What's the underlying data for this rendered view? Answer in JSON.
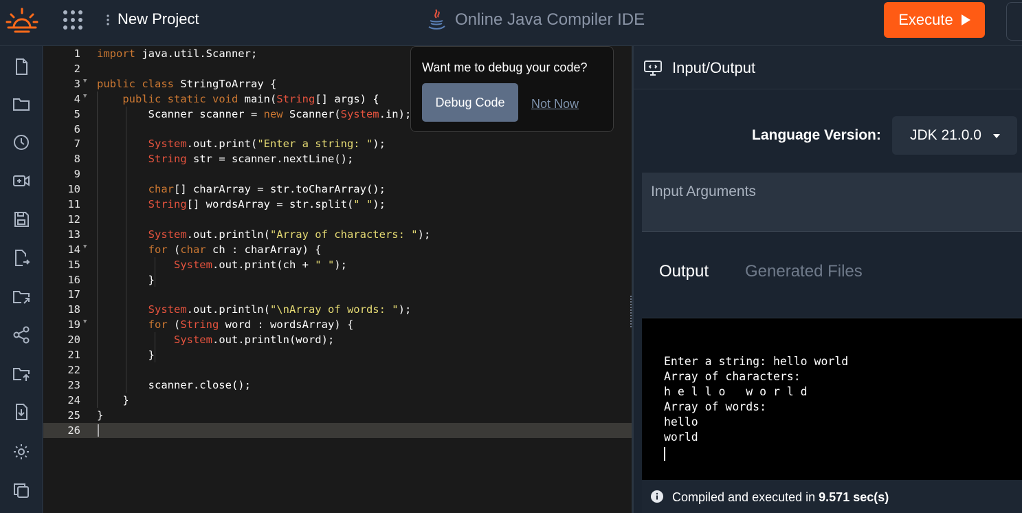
{
  "header": {
    "project_title": "New Project",
    "app_title": "Online Java Compiler IDE",
    "execute_label": "Execute"
  },
  "sidebar": {
    "icons": [
      "file-icon",
      "folder-icon",
      "history-icon",
      "video-add-icon",
      "save-icon",
      "file-export-icon",
      "folder-share-icon",
      "share-icon",
      "folder-upload-icon",
      "download-icon",
      "settings-icon",
      "copy-icon"
    ]
  },
  "editor": {
    "lines": [
      {
        "n": "1",
        "fold": "",
        "html": "import java.util.Scanner;"
      },
      {
        "n": "2",
        "fold": "",
        "html": ""
      },
      {
        "n": "3",
        "fold": "▼",
        "html": "public class StringToArray {"
      },
      {
        "n": "4",
        "fold": "▼",
        "html": "    public static void main(<span class=\"ty\">String</span>[] args) {"
      },
      {
        "n": "5",
        "fold": "",
        "html": "        Scanner scanner = new Scanner(<span class=\"ty\">System</span>.in);"
      },
      {
        "n": "6",
        "fold": "",
        "html": ""
      },
      {
        "n": "7",
        "fold": "",
        "html": "        <span class=\"ty\">System</span>.out.print(<span class=\"str\">\"Enter a string: \"</span>);"
      },
      {
        "n": "8",
        "fold": "",
        "html": "        <span class=\"ty\">String</span> str = scanner.nextLine();"
      },
      {
        "n": "9",
        "fold": "",
        "html": ""
      },
      {
        "n": "10",
        "fold": "",
        "html": "        <span class=\"kw\">char</span>[] charArray = str.toCharArray();"
      },
      {
        "n": "11",
        "fold": "",
        "html": "        <span class=\"ty\">String</span>[] wordsArray = str.split(<span class=\"str\">\" \"</span>);"
      },
      {
        "n": "12",
        "fold": "",
        "html": ""
      },
      {
        "n": "13",
        "fold": "",
        "html": "        <span class=\"ty\">System</span>.out.println(<span class=\"str\">\"Array of characters: \"</span>);"
      },
      {
        "n": "14",
        "fold": "▼",
        "html": "        <span class=\"kw\">for</span> (<span class=\"kw\">char</span> ch : charArray) {"
      },
      {
        "n": "15",
        "fold": "",
        "html": "            <span class=\"ty\">System</span>.out.print(ch + <span class=\"str\">\" \"</span>);"
      },
      {
        "n": "16",
        "fold": "",
        "html": "        }"
      },
      {
        "n": "17",
        "fold": "",
        "html": ""
      },
      {
        "n": "18",
        "fold": "",
        "html": "        <span class=\"ty\">System</span>.out.println(<span class=\"str\">\"\\nArray of words: \"</span>);"
      },
      {
        "n": "19",
        "fold": "▼",
        "html": "        <span class=\"kw\">for</span> (<span class=\"ty\">String</span> word : wordsArray) {"
      },
      {
        "n": "20",
        "fold": "",
        "html": "            <span class=\"ty\">System</span>.out.println(word);"
      },
      {
        "n": "21",
        "fold": "",
        "html": "        }"
      },
      {
        "n": "22",
        "fold": "",
        "html": ""
      },
      {
        "n": "23",
        "fold": "",
        "html": "        scanner.close();"
      },
      {
        "n": "24",
        "fold": "",
        "html": "    }"
      },
      {
        "n": "25",
        "fold": "",
        "html": "}"
      },
      {
        "n": "26",
        "fold": "",
        "html": ""
      }
    ],
    "active_line": 26
  },
  "debug_popup": {
    "question": "Want me to debug your code?",
    "debug_label": "Debug Code",
    "not_now_label": "Not Now"
  },
  "io_panel": {
    "title": "Input/Output",
    "language_label": "Language Version:",
    "language_value": "JDK 21.0.0",
    "input_placeholder": "Input Arguments",
    "tabs": [
      "Output",
      "Generated Files"
    ],
    "output_lines": [
      "Enter a string: hello world",
      "Array of characters:",
      "h e l l o   w o r l d",
      "Array of words:",
      "hello",
      "world"
    ],
    "status_prefix": "Compiled and executed in",
    "status_time": "9.571 sec(s)"
  },
  "colors": {
    "execute": "#ff5b14",
    "keyword": "#cc7832",
    "type": "#e5533e",
    "string": "#e6db74",
    "logo": "#ff6a1a"
  }
}
